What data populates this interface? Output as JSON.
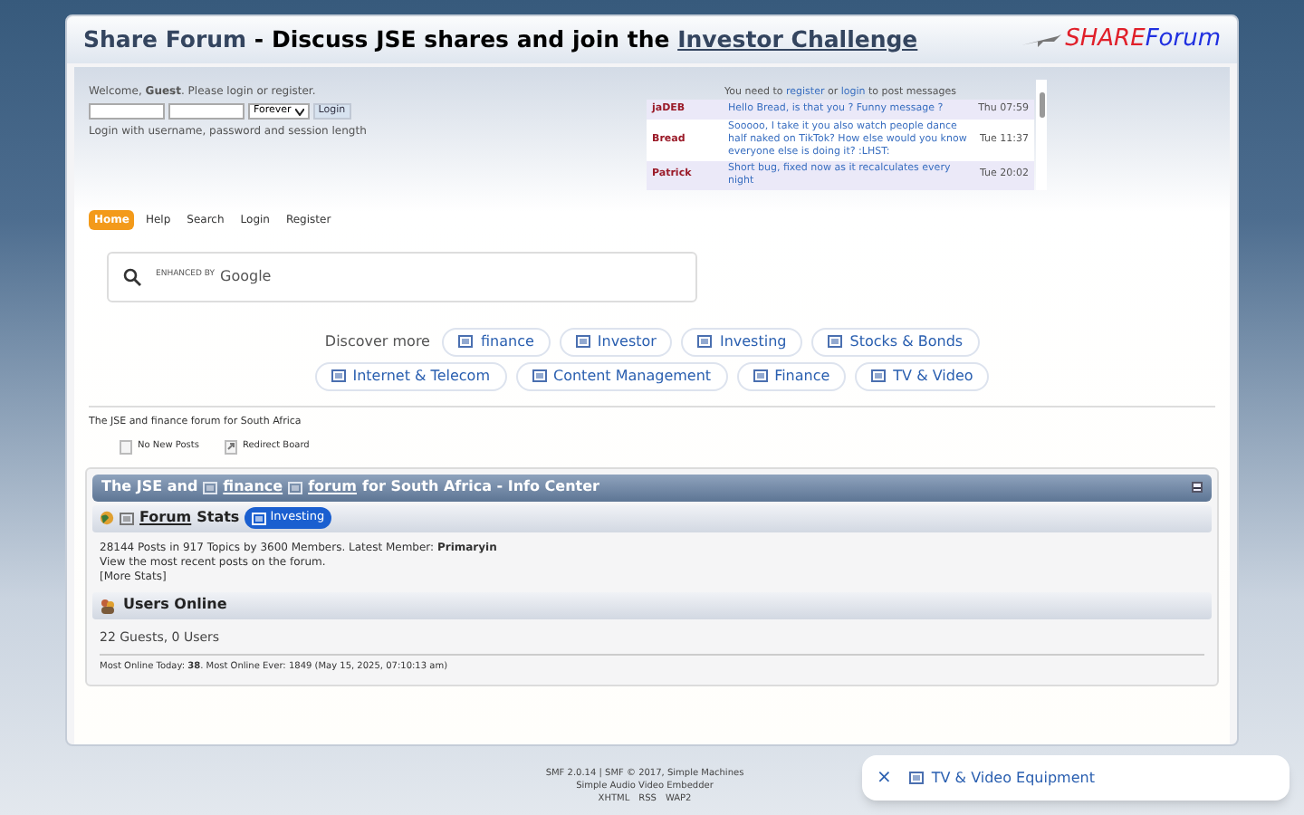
{
  "header": {
    "site": "Share Forum",
    "tagline": " - Discuss JSE shares and join the ",
    "link": "Investor Challenge",
    "logo_a": "SHARE",
    "logo_b": "Forum"
  },
  "login": {
    "welcome": "Welcome, **Guest**. Please login or register.",
    "duration": "Forever",
    "button": "Login",
    "hint": "Login with username, password and session length"
  },
  "shoutbox": {
    "before": "You need to",
    "link1": "register",
    "between": "or",
    "link2": "login",
    "after": "to post messages",
    "rows": [
      {
        "name": "jaDEB",
        "message": "Hello Bread, is that you ? Funny message ?",
        "time": "Thu 07:59",
        "selected": true
      },
      {
        "name": "Bread",
        "message": "Sooooo, I take it you also watch people dance half naked on TikTok? How else would you know everyone else is doing it?  :LHST:",
        "time": "Tue 11:37",
        "selected": false
      },
      {
        "name": "Patrick",
        "message": "Short bug, fixed now as it recalculates every night",
        "time": "Tue 20:02",
        "selected": true
      }
    ]
  },
  "menu": [
    {
      "label": "Home",
      "selected": true
    },
    {
      "label": "Help",
      "selected": false
    },
    {
      "label": "Search",
      "selected": false
    },
    {
      "label": "Login",
      "selected": false
    },
    {
      "label": "Register",
      "selected": false
    }
  ],
  "search": {
    "brand_small": "ENHANCED BY",
    "brand": "Google"
  },
  "discover": {
    "label": "Discover more",
    "rows": [
      [
        "finance",
        "Investor",
        "Investing",
        "Stocks & Bonds"
      ],
      [
        "Internet & Telecom",
        "Content Management",
        "Finance",
        "TV & Video"
      ]
    ]
  },
  "forum_tagline": "The JSE and finance forum for South Africa",
  "legend": [
    "No New Posts",
    "Redirect Board"
  ],
  "info_center": {
    "title": [
      {
        "kind": "text",
        "text": "The JSE and"
      },
      {
        "kind": "link",
        "text": "finance"
      },
      {
        "kind": "link",
        "text": "forum"
      },
      {
        "kind": "text",
        "text": "for South Africa - Info Center"
      }
    ],
    "stats_link": "Forum",
    "stats_word": "Stats",
    "stats_pill": "Investing",
    "stats": "28144 Posts in 917 Topics by 3600 Members. Latest Member: **Primaryin**",
    "recent": "View the most recent posts on the forum.",
    "more": "[More Stats]",
    "online_title": "Users Online",
    "online": "22 Guests, 0 Users",
    "most": "Most Online Today: **38**. Most Online Ever: 1849 (May 15, 2025, 07:10:13 am)"
  },
  "footer": {
    "line1": "SMF 2.0.14 | SMF © 2017, Simple Machines",
    "line2": "Simple Audio Video Embedder",
    "links": [
      "XHTML",
      "RSS",
      "WAP2"
    ]
  },
  "popup": {
    "close": "×",
    "label": "TV & Video Equipment"
  }
}
